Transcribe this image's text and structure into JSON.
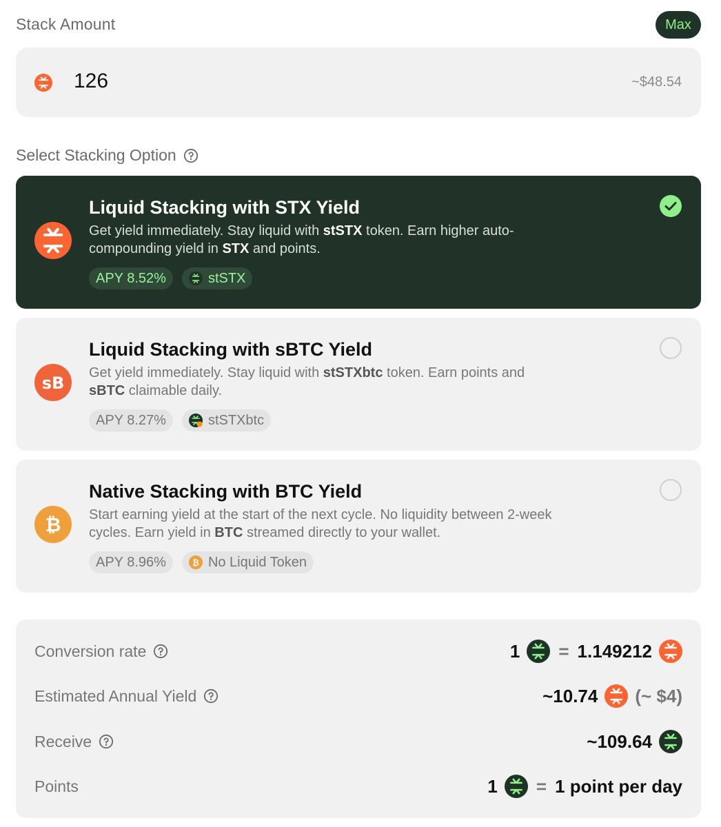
{
  "stack": {
    "label": "Stack Amount",
    "max_label": "Max",
    "amount": "126",
    "usd": "~$48.54",
    "token_icon": "stx-icon"
  },
  "select": {
    "label": "Select Stacking Option",
    "info_icon": "question-icon"
  },
  "options": [
    {
      "title": "Liquid Stacking with STX Yield",
      "desc_parts": [
        "Get yield immediately. Stay liquid with ",
        "stSTX",
        " token. Earn higher auto-compounding yield in ",
        "STX",
        " and points."
      ],
      "apy": "APY 8.52%",
      "token": "stSTX",
      "icon": "stx-icon",
      "selected": true
    },
    {
      "title": "Liquid Stacking with sBTC Yield",
      "desc_parts": [
        "Get yield immediately. Stay liquid with ",
        "stSTXbtc",
        " token. Earn points and ",
        "sBTC",
        " claimable daily."
      ],
      "apy": "APY 8.27%",
      "token": "stSTXbtc",
      "icon": "sbtc-icon",
      "selected": false
    },
    {
      "title": "Native Stacking with BTC Yield",
      "desc_parts": [
        "Start earning yield at the start of the next cycle. No liquidity between 2-week cycles. Earn yield in ",
        "BTC",
        " streamed directly to your wallet."
      ],
      "apy": "APY 8.96%",
      "token": "No Liquid Token",
      "icon": "btc-icon",
      "selected": false
    }
  ],
  "summary": {
    "conversion": {
      "label": "Conversion rate",
      "lhs": "1",
      "eq": "=",
      "rhs": "1.149212"
    },
    "yield": {
      "label": "Estimated Annual Yield",
      "value": "~10.74",
      "usd": "(~ $4)"
    },
    "receive": {
      "label": "Receive",
      "value": "~109.64"
    },
    "points": {
      "label": "Points",
      "lhs": "1",
      "eq": "=",
      "rhs": "1 point per day"
    }
  },
  "colors": {
    "stx_orange": "#fc6432",
    "dark_green": "#213328",
    "accent_green": "#8ff08a",
    "btc_orange": "#f7931a"
  }
}
